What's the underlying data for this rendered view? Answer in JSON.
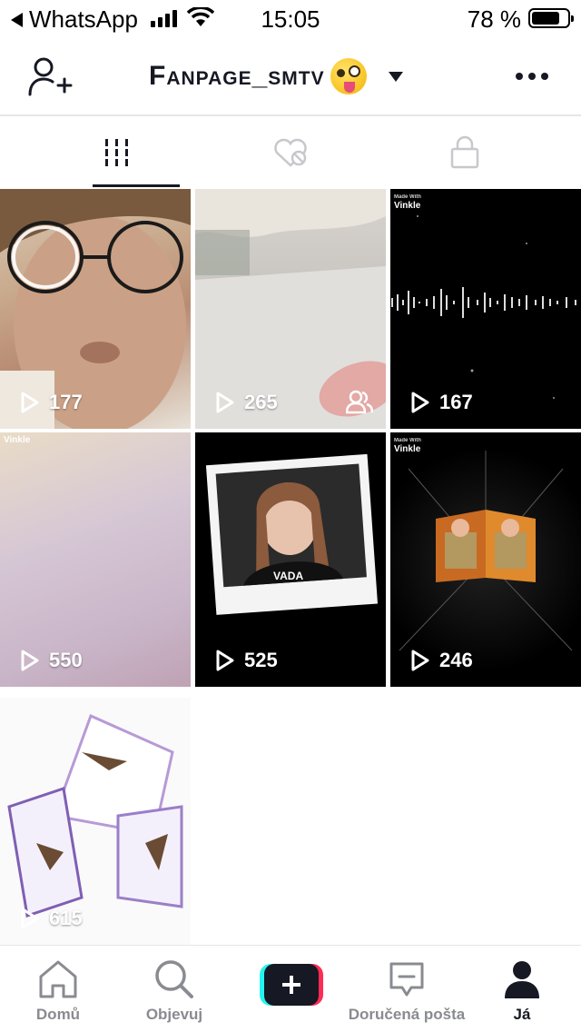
{
  "status_bar": {
    "back_app": "WhatsApp",
    "time": "15:05",
    "battery_percent": "78 %",
    "battery_level": 0.78
  },
  "header": {
    "username": "Fanpage_smtv",
    "icons": [
      "add-user-icon",
      "dropdown-caret-icon",
      "more-icon"
    ]
  },
  "tabs": [
    {
      "icon": "grid-icon",
      "active": true
    },
    {
      "icon": "hidden-likes-icon",
      "active": false
    },
    {
      "icon": "lock-icon",
      "active": false
    }
  ],
  "videos": [
    {
      "views": "177",
      "theme": "selfie-glasses"
    },
    {
      "views": "265",
      "theme": "blurry-hand",
      "collab": true
    },
    {
      "views": "167",
      "theme": "audio-wave",
      "made_with_label": "Made With",
      "app_label": "Vinkle"
    },
    {
      "views": "550",
      "theme": "gradient",
      "app_label": "Vinkle"
    },
    {
      "views": "525",
      "theme": "polaroid-girl",
      "poster_text": "VADA"
    },
    {
      "views": "246",
      "theme": "cube-fire",
      "made_with_label": "Made With",
      "app_label": "Vinkle"
    },
    {
      "views": "615",
      "theme": "bird-cube"
    }
  ],
  "bottom_nav": {
    "items": [
      {
        "label": "Domů",
        "icon": "home-icon"
      },
      {
        "label": "Objevuj",
        "icon": "search-icon"
      },
      {
        "label": "",
        "icon": "create-plus-icon"
      },
      {
        "label": "Doručená pošta",
        "icon": "inbox-icon"
      },
      {
        "label": "Já",
        "icon": "profile-icon",
        "active": true
      }
    ]
  },
  "colors": {
    "text_primary": "#161823",
    "nav_inactive": "#8a8b91",
    "create_cyan": "#25f4ee",
    "create_red": "#fe2c55",
    "divider": "#e6e6e6"
  }
}
